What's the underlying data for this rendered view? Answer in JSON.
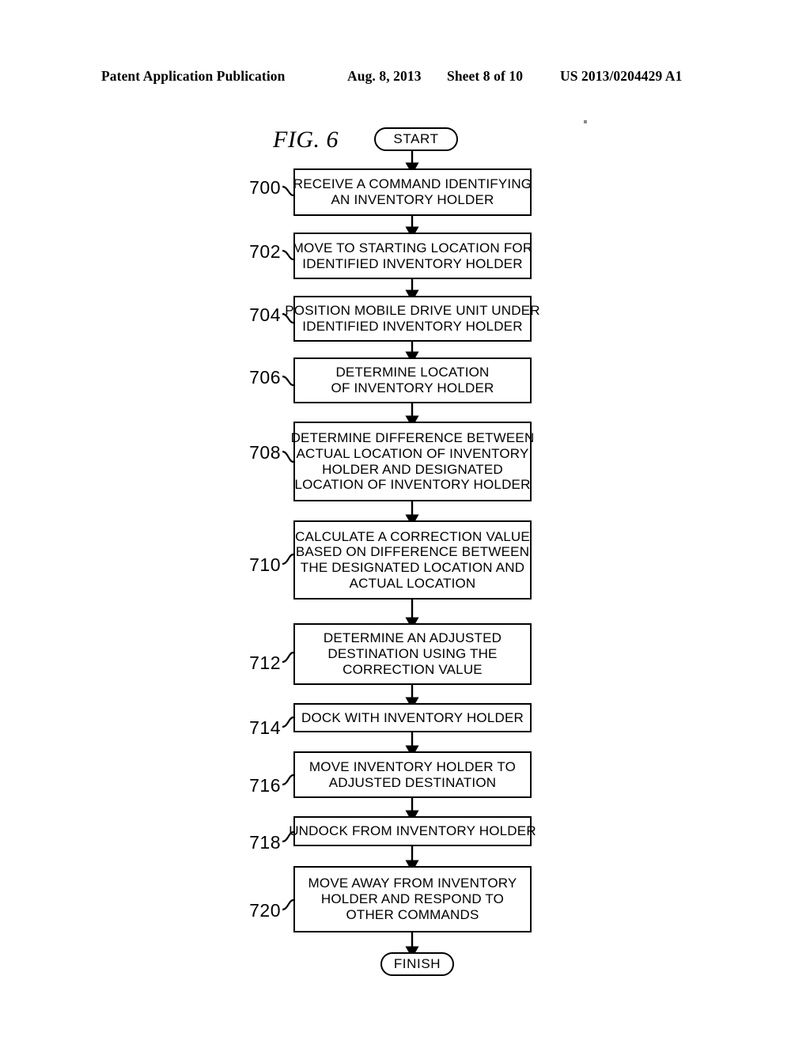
{
  "header": {
    "publication": "Patent Application Publication",
    "date": "Aug. 8, 2013",
    "sheet": "Sheet 8 of 10",
    "patent_number": "US 2013/0204429 A1"
  },
  "figure": {
    "title": "FIG. 6"
  },
  "flowchart": {
    "start_label": "START",
    "finish_label": "FINISH",
    "steps": [
      {
        "ref": "700",
        "lines": [
          "RECEIVE A COMMAND IDENTIFYING",
          "AN INVENTORY HOLDER"
        ]
      },
      {
        "ref": "702",
        "lines": [
          "MOVE TO STARTING LOCATION FOR",
          "IDENTIFIED INVENTORY HOLDER"
        ]
      },
      {
        "ref": "704",
        "lines": [
          "POSITION MOBILE DRIVE UNIT UNDER",
          "IDENTIFIED INVENTORY HOLDER"
        ]
      },
      {
        "ref": "706",
        "lines": [
          "DETERMINE LOCATION",
          "OF INVENTORY HOLDER"
        ]
      },
      {
        "ref": "708",
        "lines": [
          "DETERMINE DIFFERENCE BETWEEN",
          "ACTUAL LOCATION OF INVENTORY",
          "HOLDER AND DESIGNATED",
          "LOCATION OF INVENTORY HOLDER"
        ]
      },
      {
        "ref": "710",
        "lines": [
          "CALCULATE A CORRECTION VALUE",
          "BASED ON DIFFERENCE BETWEEN",
          "THE DESIGNATED LOCATION AND",
          "ACTUAL LOCATION"
        ]
      },
      {
        "ref": "712",
        "lines": [
          "DETERMINE AN ADJUSTED",
          "DESTINATION USING THE",
          "CORRECTION VALUE"
        ]
      },
      {
        "ref": "714",
        "lines": [
          "DOCK WITH INVENTORY HOLDER"
        ]
      },
      {
        "ref": "716",
        "lines": [
          "MOVE INVENTORY HOLDER TO",
          "ADJUSTED DESTINATION"
        ]
      },
      {
        "ref": "718",
        "lines": [
          "UNDOCK FROM INVENTORY HOLDER"
        ]
      },
      {
        "ref": "720",
        "lines": [
          "MOVE AWAY FROM INVENTORY",
          "HOLDER AND RESPOND TO",
          "OTHER COMMANDS"
        ]
      }
    ]
  },
  "colors": {
    "ink": "#000000",
    "paper": "#ffffff"
  }
}
